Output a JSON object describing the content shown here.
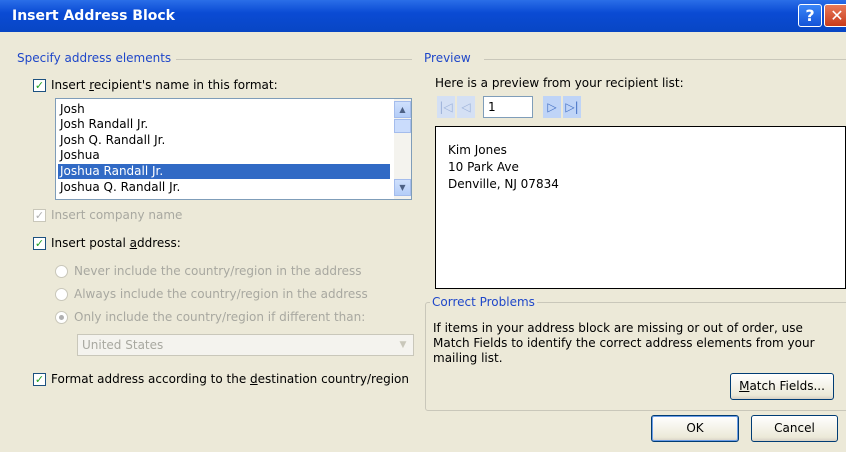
{
  "window": {
    "title": "Insert Address Block",
    "help_glyph": "?",
    "close_glyph": "✕"
  },
  "left": {
    "group_label": "Specify address elements",
    "name_format": {
      "checked": true,
      "label_pre": "Insert ",
      "label_ul": "r",
      "label_post": "ecipient's name in this format:",
      "items": [
        "Josh",
        "Josh Randall Jr.",
        "Josh Q. Randall Jr.",
        "Joshua",
        "Joshua Randall Jr.",
        "Joshua Q. Randall Jr."
      ],
      "selected_index": 4
    },
    "company": {
      "label": "Insert company name",
      "checked": true,
      "disabled": true
    },
    "postal": {
      "checked": true,
      "label_pre": "Insert postal ",
      "label_ul": "a",
      "label_post": "ddress:",
      "options": [
        "Never include the country/region in the address",
        "Always include the country/region in the address",
        "Only include the country/region if different than:"
      ],
      "selected_option": 2,
      "country": "United States"
    },
    "format_dest": {
      "checked": true,
      "label_pre": "Format address according to the ",
      "label_ul": "d",
      "label_post": "estination country/region"
    }
  },
  "right": {
    "group_label": "Preview",
    "preview_caption": "Here is a preview from your recipient list:",
    "record_number": "1",
    "address_lines": [
      "Kim Jones",
      "10 Park Ave",
      "Denville, NJ 07834"
    ],
    "correct_label": "Correct Problems",
    "correct_text": "If items in your address block are missing or out of order, use Match Fields to identify the correct address elements from your mailing list.",
    "match_pre": "",
    "match_ul": "M",
    "match_post": "atch Fields..."
  },
  "footer": {
    "ok": "OK",
    "cancel": "Cancel"
  },
  "colors": {
    "title_bar": "#0a4bd4",
    "selection": "#316ac5",
    "group_label": "#1f47c9"
  }
}
